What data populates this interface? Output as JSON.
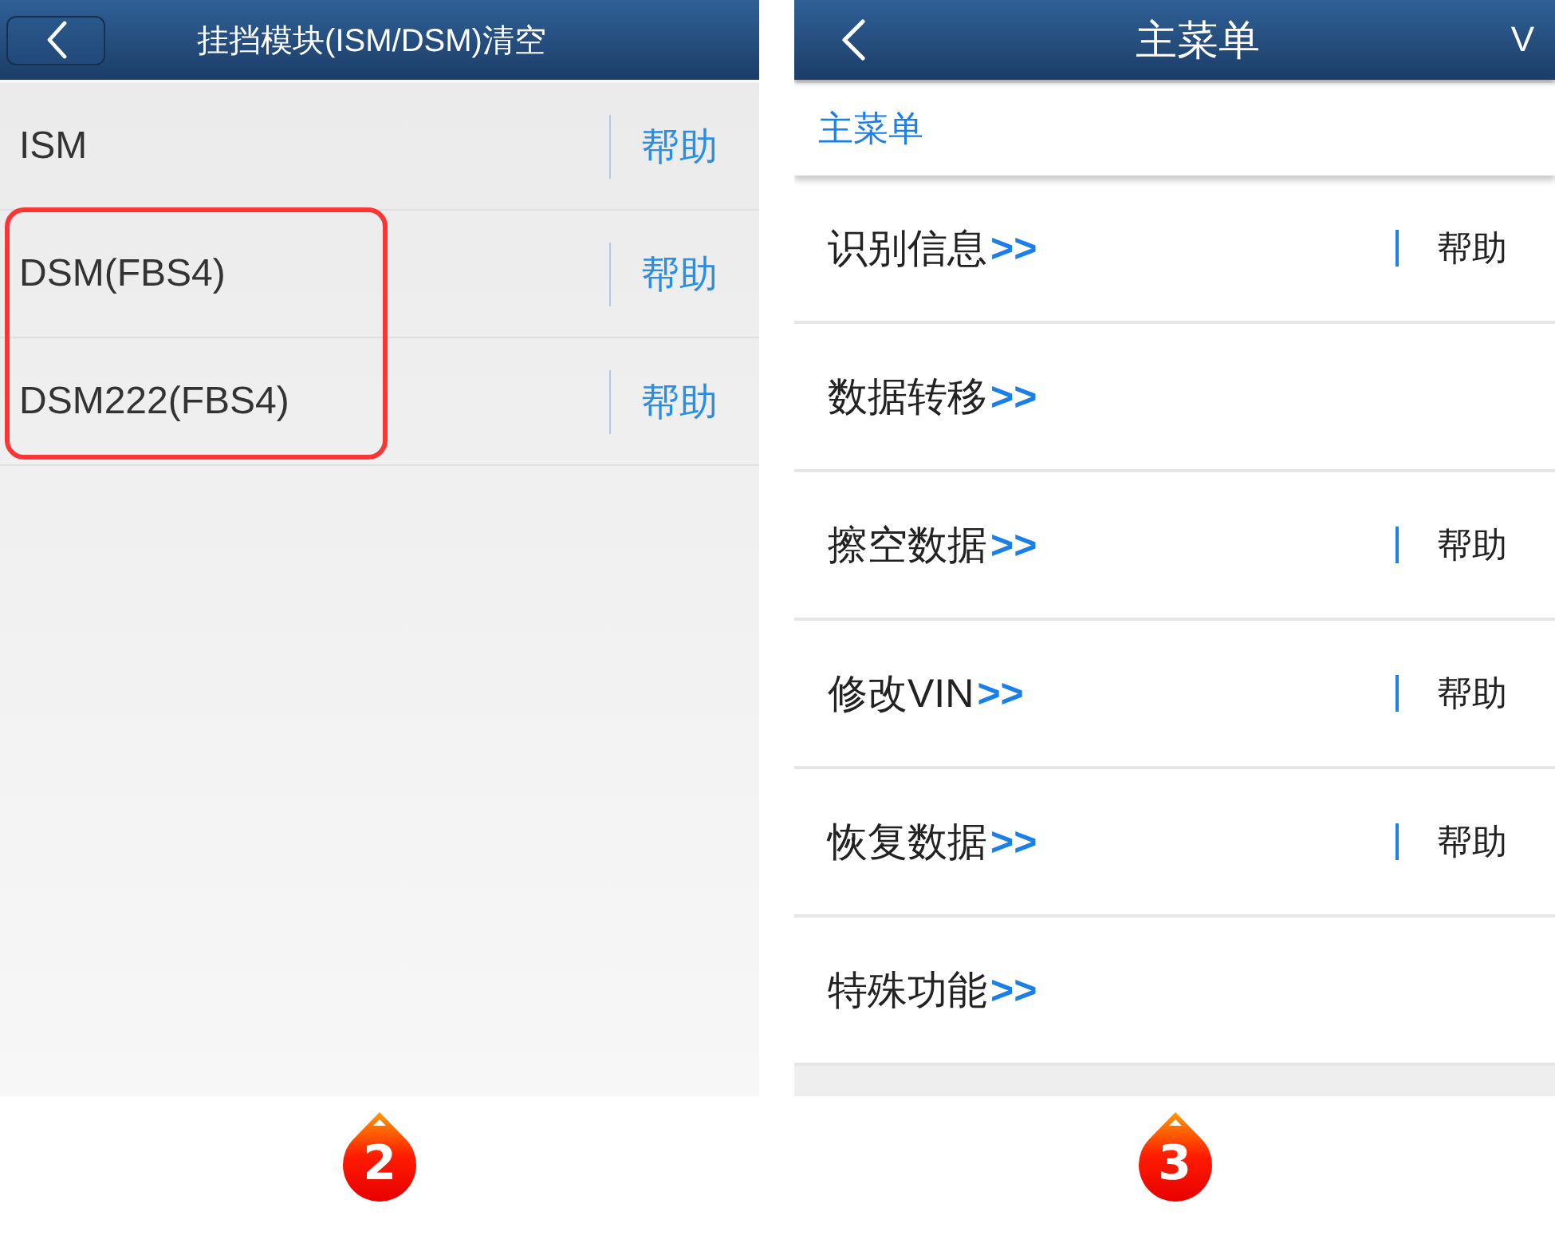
{
  "panels": [
    {
      "kind": "list",
      "header": {
        "title": "挂挡模块(ISM/DSM)清空"
      },
      "rows": [
        {
          "label": "ISM",
          "help": "帮助",
          "highlighted": false
        },
        {
          "label": "DSM(FBS4)",
          "help": "帮助",
          "highlighted": true
        },
        {
          "label": "DSM222(FBS4)",
          "help": "帮助",
          "highlighted": true
        }
      ],
      "badge": "2"
    },
    {
      "kind": "menu",
      "header": {
        "title": "主菜单",
        "action": "V"
      },
      "breadcrumb": "主菜单",
      "items": [
        {
          "label": "识别信息",
          "suffix": ">>",
          "help": "帮助"
        },
        {
          "label": "数据转移",
          "suffix": ">>"
        },
        {
          "label": "擦空数据",
          "suffix": ">>",
          "help": "帮助"
        },
        {
          "label": "修改VIN",
          "suffix": ">>",
          "help": "帮助"
        },
        {
          "label": "恢复数据",
          "suffix": ">>",
          "help": "帮助"
        },
        {
          "label": "特殊功能",
          "suffix": ">>"
        }
      ],
      "badge": "3"
    }
  ]
}
